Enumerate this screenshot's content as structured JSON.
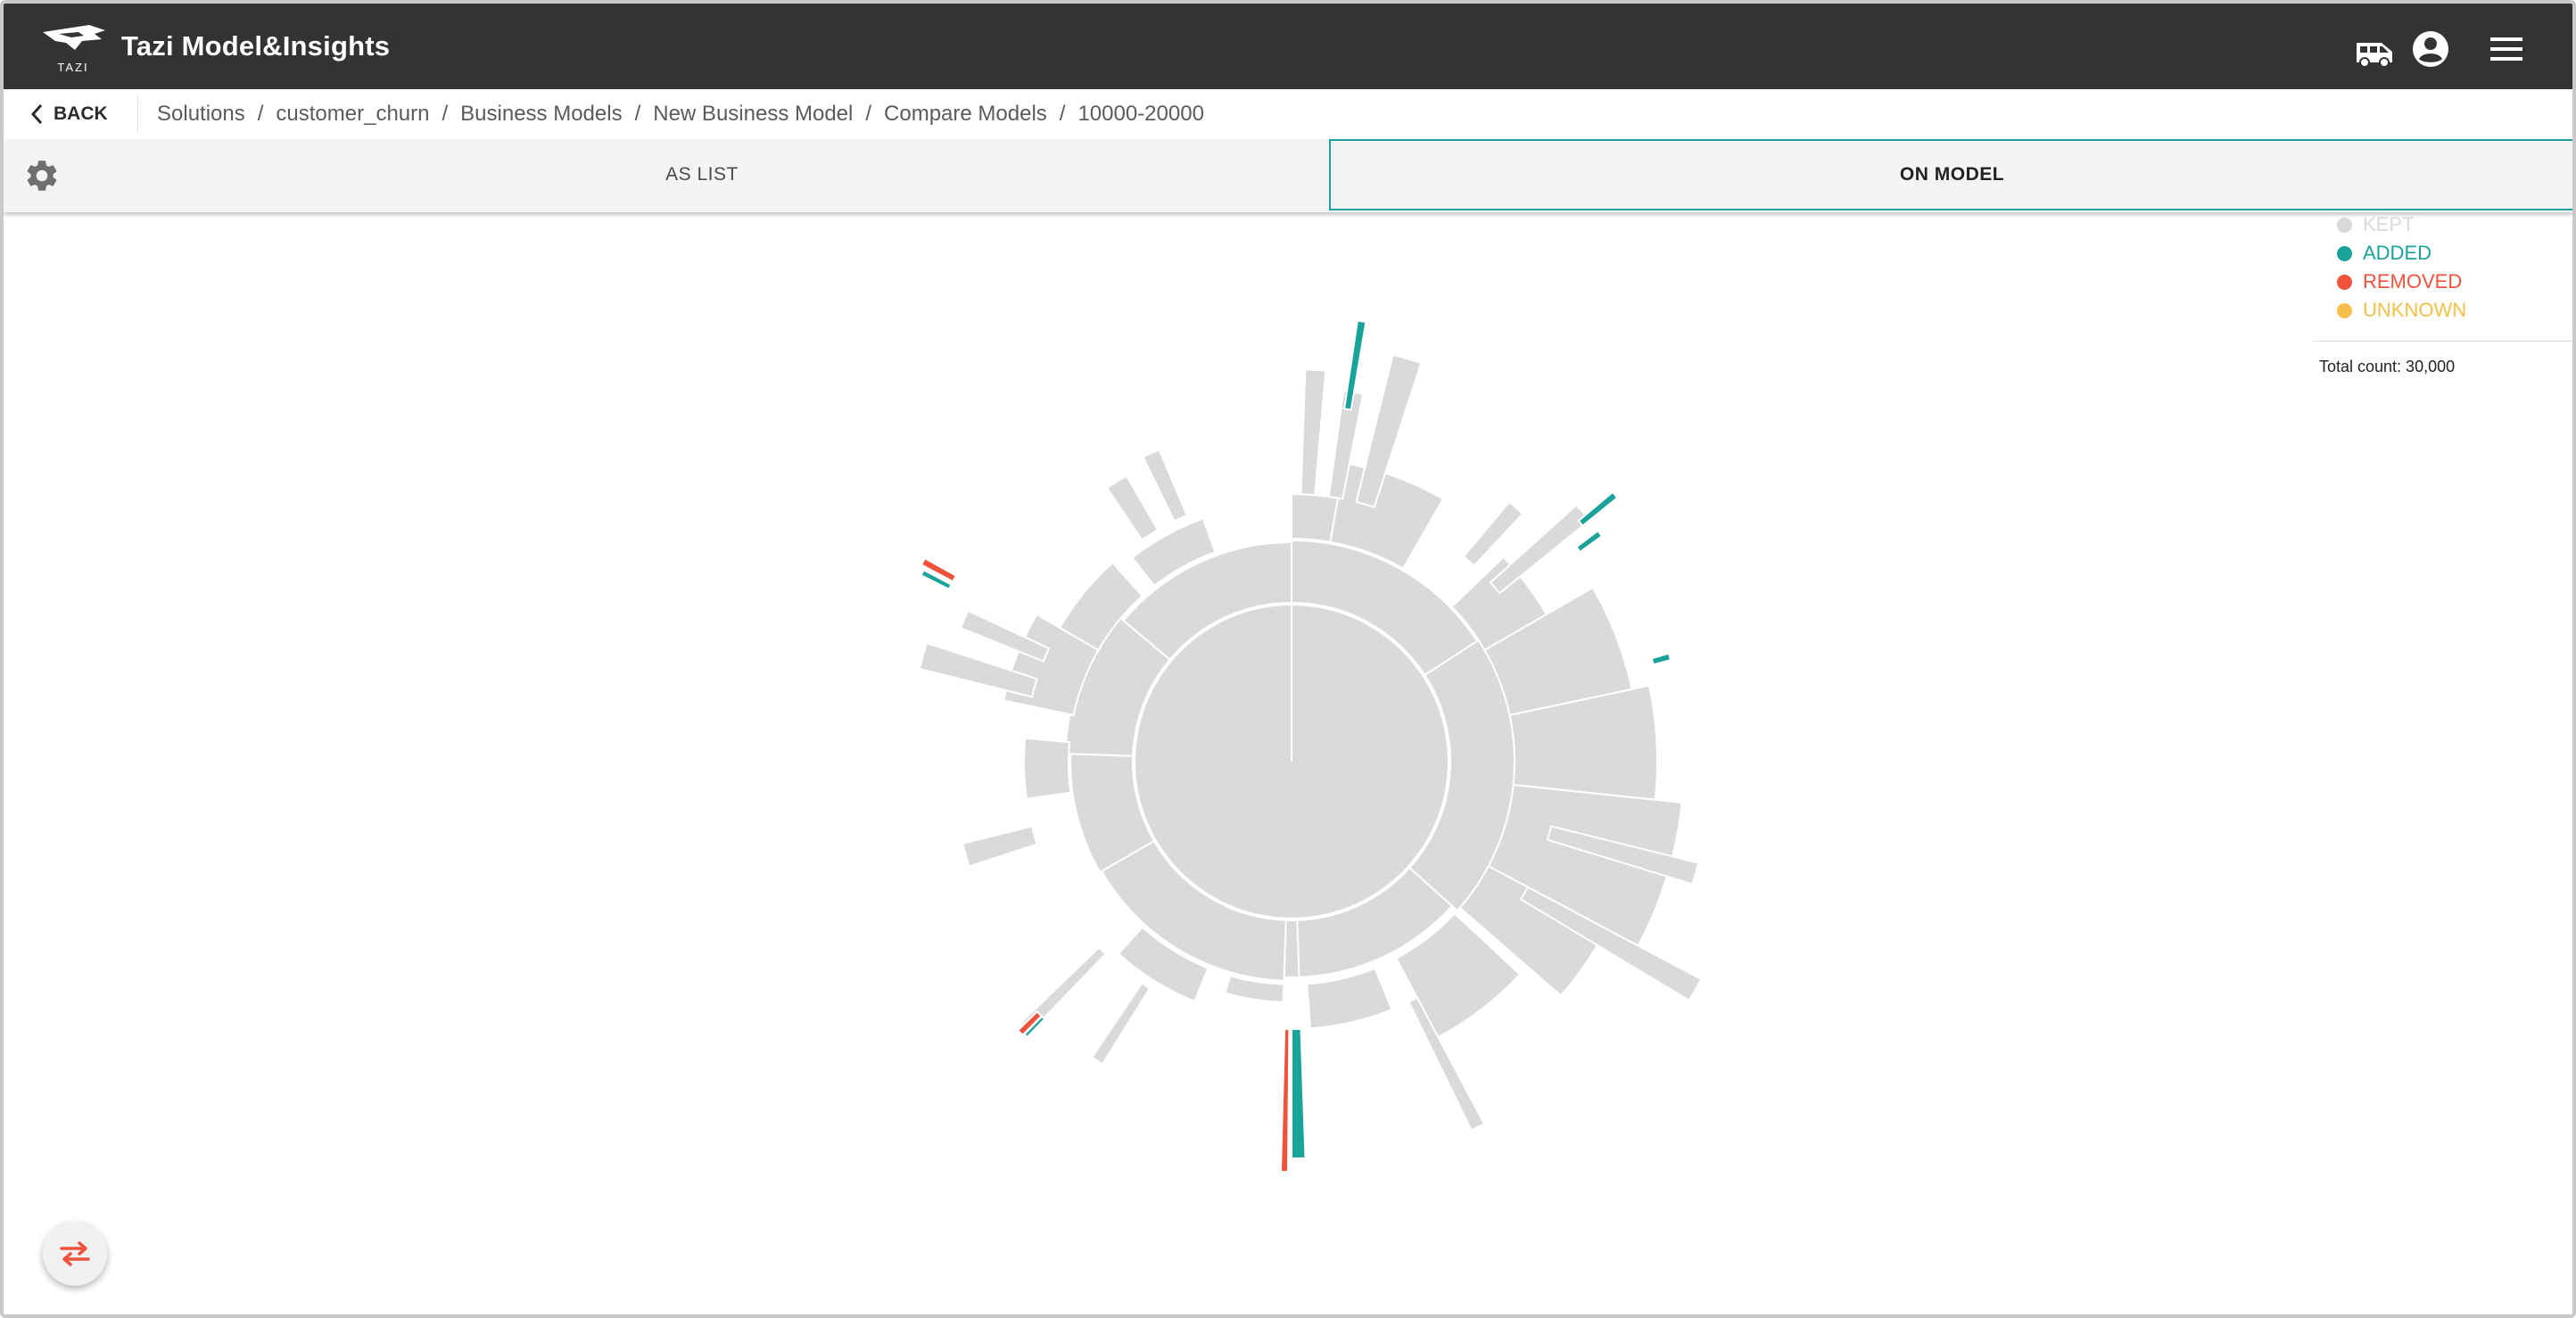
{
  "app": {
    "title": "Tazi Model&Insights",
    "logo_text": "TAZI"
  },
  "header_icons": [
    "shuttle-van-icon",
    "account-circle-icon",
    "menu-icon"
  ],
  "breadcrumb": {
    "back_label": "BACK",
    "items": [
      "Solutions",
      "customer_churn",
      "Business Models",
      "New Business Model",
      "Compare Models",
      "10000-20000"
    ],
    "separator": "/"
  },
  "tabs": {
    "as_list": "AS LIST",
    "on_model": "ON MODEL",
    "active": "ON MODEL"
  },
  "legend": {
    "items": [
      {
        "label": "KEPT",
        "color": "#d9d9d9"
      },
      {
        "label": "ADDED",
        "color": "#1aa39a"
      },
      {
        "label": "REMOVED",
        "color": "#f0523c"
      },
      {
        "label": "UNKNOWN",
        "color": "#f5c04a"
      }
    ],
    "total_label": "Total count: 30,000"
  },
  "colors": {
    "kept": "#dadada",
    "added": "#1aa39a",
    "removed": "#f0523c",
    "unknown": "#f5c04a",
    "header": "#343233",
    "accent": "#1aa39a"
  }
}
